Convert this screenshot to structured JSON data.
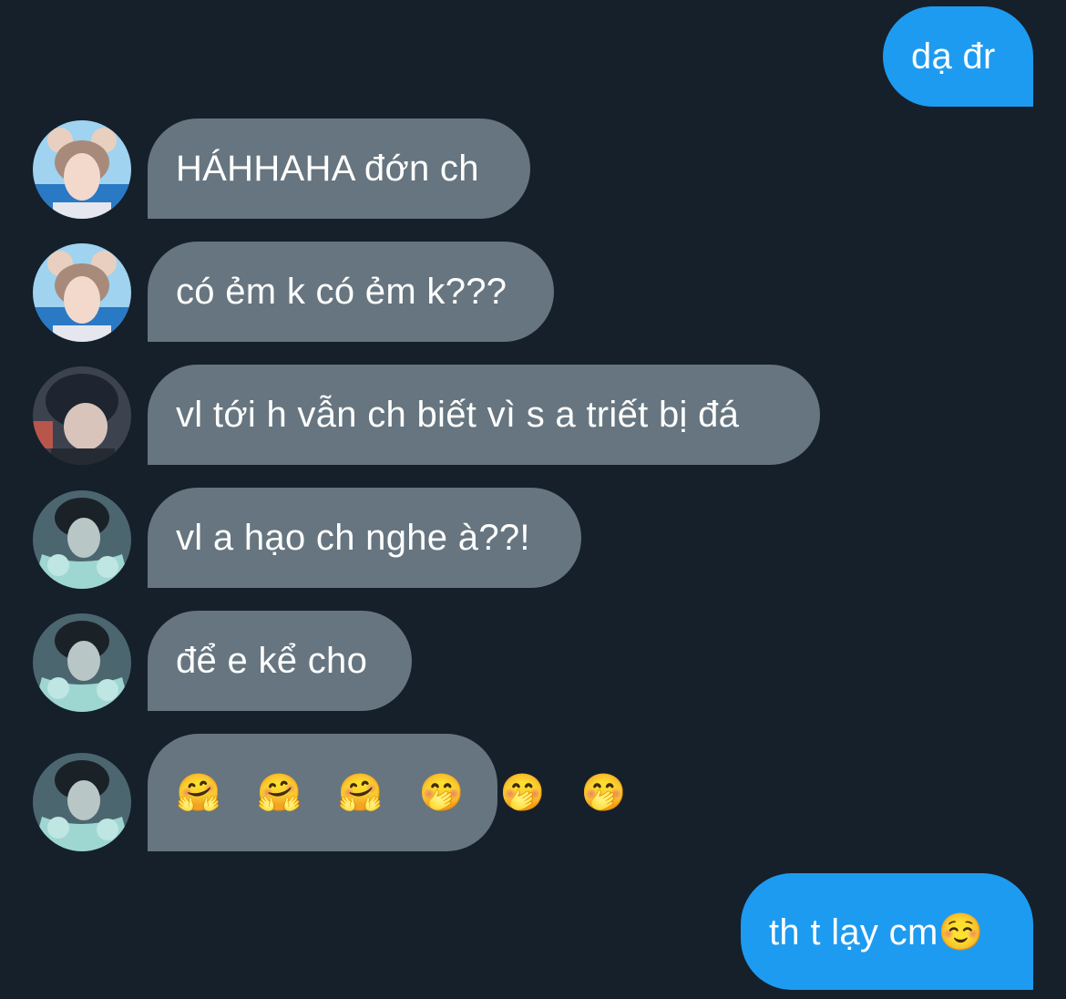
{
  "conversation": {
    "messages": [
      {
        "direction": "outgoing",
        "text": "dạ đr"
      },
      {
        "direction": "incoming",
        "sender_avatar": "avatar-pink-bear-ears",
        "text": "HÁHHAHA đớn ch"
      },
      {
        "direction": "incoming",
        "sender_avatar": "avatar-pink-bear-ears",
        "text": "có ẻm k có ẻm k???"
      },
      {
        "direction": "incoming",
        "sender_avatar": "avatar-dark-hood-selfie",
        "text": "vl tới h vẫn ch biết vì s a triết bị đá"
      },
      {
        "direction": "incoming",
        "sender_avatar": "avatar-teal-fur-coat",
        "text": "vl a hạo ch nghe à??!"
      },
      {
        "direction": "incoming",
        "sender_avatar": "avatar-teal-fur-coat",
        "text": "để e kể cho"
      },
      {
        "direction": "incoming",
        "sender_avatar": "avatar-teal-fur-coat",
        "text": "🤗 🤗 🤗 🤭 🤭 🤭"
      },
      {
        "direction": "outgoing",
        "text": "th t lạy cm☺️"
      }
    ]
  },
  "colors": {
    "background": "#15202b",
    "incoming_bubble": "#66757f",
    "outgoing_bubble": "#1d9bf0",
    "text": "#ffffff"
  }
}
